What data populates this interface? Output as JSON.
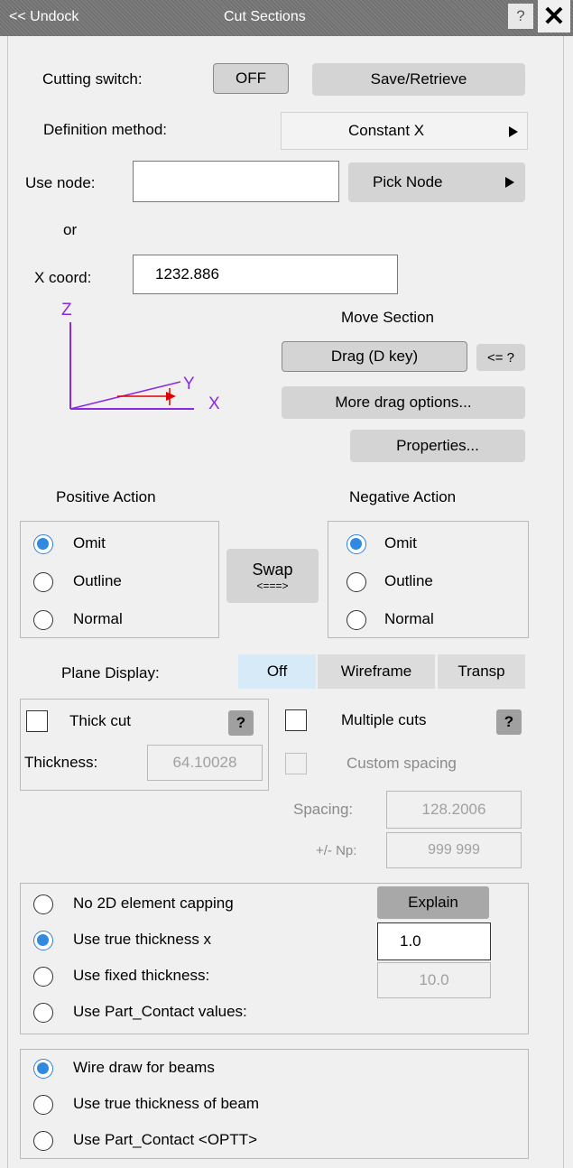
{
  "titlebar": {
    "undock": "<< Undock",
    "title": "Cut Sections",
    "help": "?",
    "close": "✕"
  },
  "cutting": {
    "label": "Cutting switch:",
    "switch": "OFF",
    "save": "Save/Retrieve"
  },
  "definition": {
    "label": "Definition method:",
    "value": "Constant X"
  },
  "node": {
    "label": "Use node:",
    "value": "",
    "pick": "Pick Node"
  },
  "or_label": "or",
  "xcoord": {
    "label": "X coord:",
    "value": "1232.886"
  },
  "axes": {
    "z": "Z",
    "y": "Y",
    "x": "X"
  },
  "move": {
    "title": "Move Section",
    "drag": "Drag (D key)",
    "drag_help": "<= ?",
    "more": "More drag options...",
    "properties": "Properties..."
  },
  "positive": {
    "title": "Positive Action",
    "options": [
      "Omit",
      "Outline",
      "Normal"
    ],
    "selected": "Omit"
  },
  "negative": {
    "title": "Negative Action",
    "options": [
      "Omit",
      "Outline",
      "Normal"
    ],
    "selected": "Omit"
  },
  "swap": {
    "label": "Swap",
    "arrow": "<===>"
  },
  "plane": {
    "label": "Plane Display:",
    "tabs": [
      "Off",
      "Wireframe",
      "Transp"
    ],
    "active": "Off"
  },
  "thick": {
    "label": "Thick cut",
    "help": "?",
    "thickness_label": "Thickness:",
    "thickness": "64.10028"
  },
  "multiple": {
    "label": "Multiple cuts",
    "help": "?",
    "custom": "Custom spacing",
    "spacing_label": "Spacing:",
    "spacing": "128.2006",
    "np_label": "+/- Np:",
    "np": "999  999"
  },
  "capping": {
    "options": [
      "No 2D element capping",
      "Use true thickness  x",
      "Use fixed thickness:",
      "Use Part_Contact values:"
    ],
    "selected": "Use true thickness  x",
    "explain": "Explain",
    "true_value": "1.0",
    "fixed_value": "10.0"
  },
  "beams": {
    "options": [
      "Wire draw for beams",
      "Use true thickness of beam",
      "Use Part_Contact <OPTT>"
    ],
    "selected": "Wire draw for beams"
  },
  "colors": {
    "accent": "#2f8ae0",
    "active_tab": "#d6eaf8",
    "title_bg": "#757575"
  }
}
